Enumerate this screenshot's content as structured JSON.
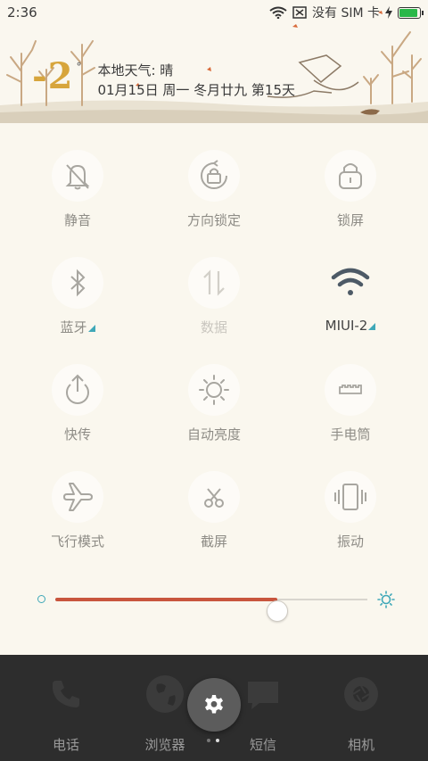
{
  "status_bar": {
    "time": "2:36",
    "carrier": "没有 SIM 卡",
    "icons": [
      "wifi-icon",
      "no-sim-icon",
      "charging-icon",
      "battery-icon"
    ],
    "battery_level": 0.9
  },
  "weather": {
    "temperature": "-2",
    "unit": "°",
    "line1": "本地天气: 晴",
    "line2": "01月15日 周一 冬月廿九 第15天"
  },
  "quick_settings": {
    "tiles": [
      {
        "label": "静音",
        "icon": "silent-bell-icon",
        "state": "off"
      },
      {
        "label": "方向锁定",
        "icon": "rotation-lock-icon",
        "state": "off"
      },
      {
        "label": "锁屏",
        "icon": "lock-screen-icon",
        "state": "off"
      },
      {
        "label": "蓝牙",
        "icon": "bluetooth-icon",
        "state": "off"
      },
      {
        "label": "数据",
        "icon": "mobile-data-icon",
        "state": "disabled"
      },
      {
        "label": "MIUI-2",
        "icon": "wifi-icon",
        "state": "on"
      },
      {
        "label": "快传",
        "icon": "quick-share-icon",
        "state": "off"
      },
      {
        "label": "自动亮度",
        "icon": "auto-brightness-icon",
        "state": "off"
      },
      {
        "label": "手电筒",
        "icon": "flashlight-icon",
        "state": "off"
      },
      {
        "label": "飞行模式",
        "icon": "airplane-icon",
        "state": "off"
      },
      {
        "label": "截屏",
        "icon": "screenshot-icon",
        "state": "off"
      },
      {
        "label": "振动",
        "icon": "vibrate-icon",
        "state": "off"
      }
    ],
    "brightness_level": 0.71
  },
  "dock": {
    "items": [
      {
        "label": "电话",
        "icon": "phone-icon"
      },
      {
        "label": "浏览器",
        "icon": "browser-icon"
      },
      {
        "label": "短信",
        "icon": "messages-icon"
      },
      {
        "label": "相机",
        "icon": "camera-icon"
      }
    ],
    "settings_icon": "settings-gear-icon"
  },
  "colors": {
    "accent": "#3fa8b8",
    "brightness_fill": "#c8553d",
    "temperature": "#d7a53c",
    "panel_bg": "#faf7ee",
    "dock_bg": "#2d2d2d"
  }
}
